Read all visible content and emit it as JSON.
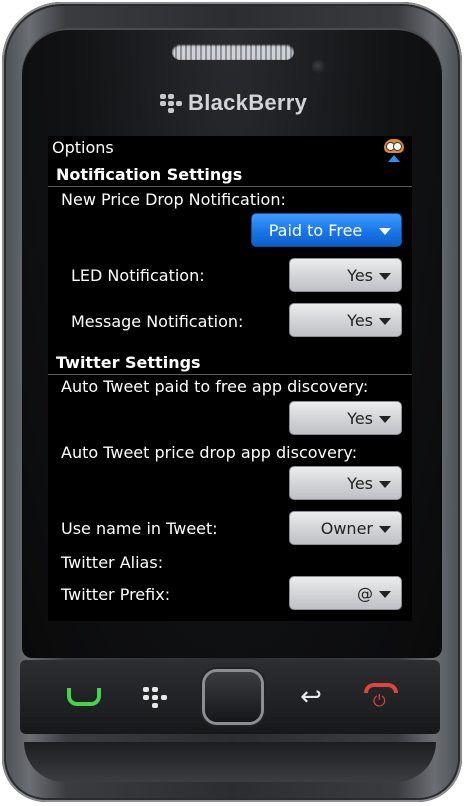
{
  "device": {
    "brand": "BlackBerry"
  },
  "screen": {
    "title": "Options",
    "notification": {
      "heading": "Notification Settings",
      "new_price_drop_label": "New Price Drop Notification:",
      "new_price_drop_value": "Paid to Free",
      "led_label": "LED Notification:",
      "led_value": "Yes",
      "message_label": "Message Notification:",
      "message_value": "Yes"
    },
    "twitter": {
      "heading": "Twitter Settings",
      "auto_tweet_paid_label": "Auto Tweet paid to free app discovery:",
      "auto_tweet_paid_value": "Yes",
      "auto_tweet_drop_label": "Auto Tweet price drop app discovery:",
      "auto_tweet_drop_value": "Yes",
      "use_name_label": "Use name in Tweet:",
      "use_name_value": "Owner",
      "alias_label": "Twitter Alias:",
      "prefix_label": "Twitter Prefix:",
      "prefix_value": "@"
    }
  },
  "icons": {
    "app_icon": "owl-icon",
    "scroll_indicator": "arrow-up-icon",
    "call_key": "call-icon",
    "menu_key": "blackberry-menu-icon",
    "back_key": "back-arrow-icon",
    "end_key": "end-call-icon"
  },
  "colors": {
    "accent_blue": "#1976e8",
    "call_green": "#45d34a",
    "end_red": "#e0443f"
  }
}
